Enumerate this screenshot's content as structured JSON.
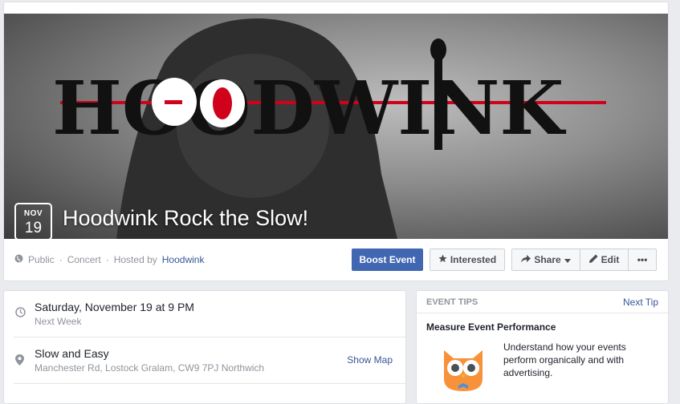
{
  "event": {
    "month": "NOV",
    "day": "19",
    "title": "Hoodwink Rock the Slow!",
    "cover_logo_text": "HOODWINK"
  },
  "meta": {
    "visibility": "Public",
    "sep1": "·",
    "category": "Concert",
    "sep2": "·",
    "hosted_by_label": "Hosted by",
    "host": "Hoodwink"
  },
  "actions": {
    "boost": "Boost Event",
    "interested": "Interested",
    "share": "Share",
    "edit": "Edit",
    "more": "•••"
  },
  "details": {
    "datetime": "Saturday, November 19 at 9 PM",
    "relative": "Next Week",
    "venue": "Slow and Easy",
    "address": "Manchester Rd, Lostock Gralam, CW9 7PJ Northwich",
    "show_map": "Show Map"
  },
  "tips": {
    "header": "EVENT TIPS",
    "next": "Next Tip",
    "title": "Measure Event Performance",
    "body": "Understand how your events perform organically and with advertising."
  },
  "colors": {
    "primary": "#4267b2",
    "link": "#365899",
    "owl_orange": "#f7923a"
  }
}
